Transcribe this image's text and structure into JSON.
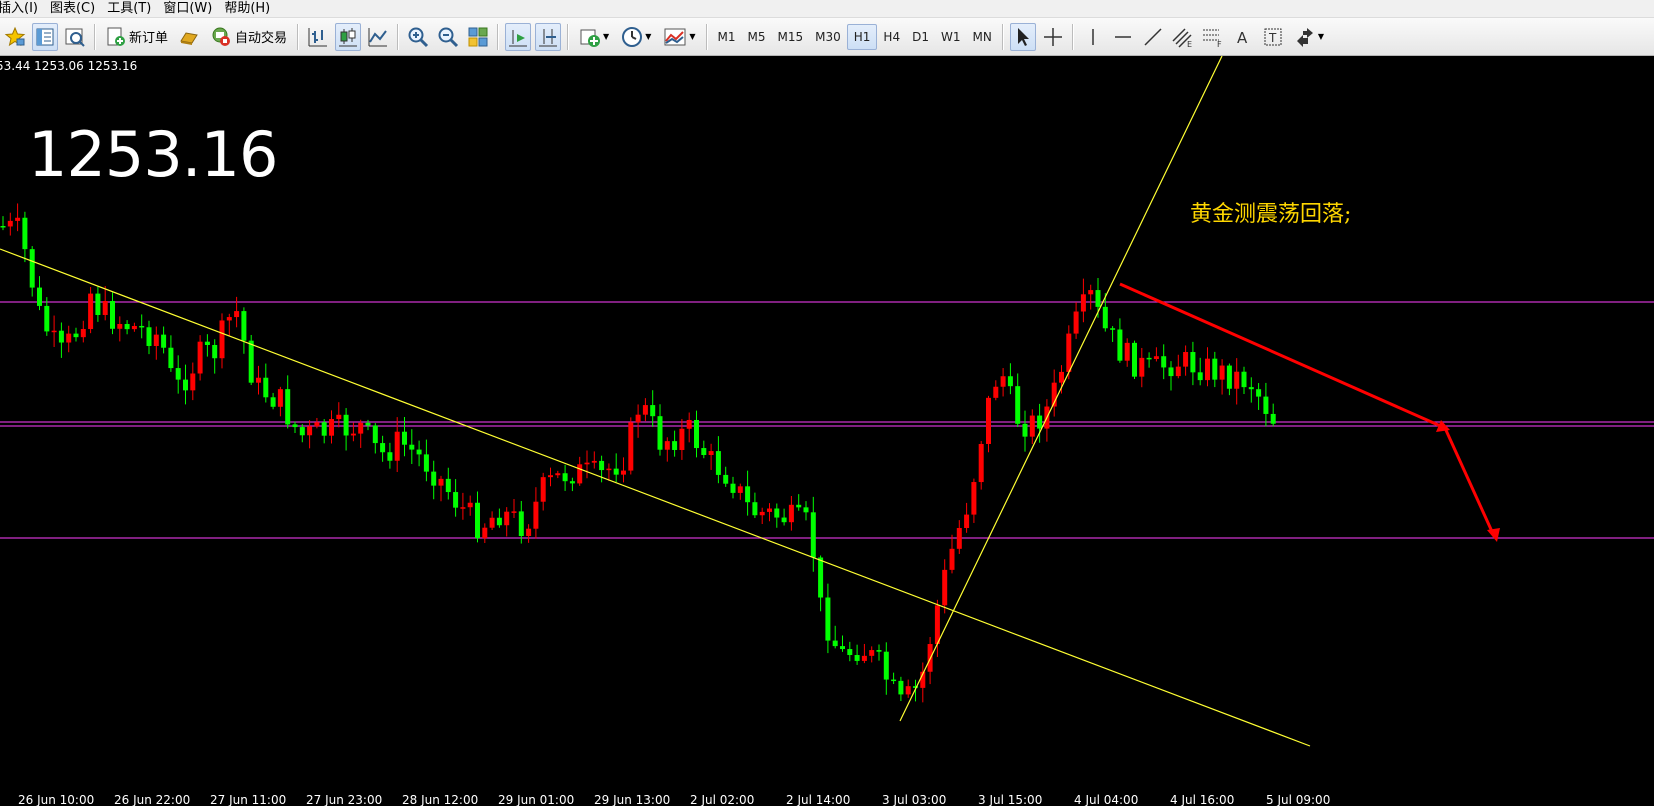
{
  "menu": {
    "items": [
      "插入(I)",
      "图表(C)",
      "工具(T)",
      "窗口(W)",
      "帮助(H)"
    ]
  },
  "toolbar": {
    "new_order_label": "新订单",
    "auto_trade_label": "自动交易",
    "timeframes": [
      "M1",
      "M5",
      "M15",
      "M30",
      "H1",
      "H4",
      "D1",
      "W1",
      "MN"
    ],
    "active_timeframe": "H1",
    "icons": [
      "profiles-icon",
      "market-watch-icon",
      "navigator-icon",
      "new-order-icon",
      "gold-icon",
      "auto-trading-icon",
      "bar-chart-icon",
      "candlestick-icon",
      "line-chart-icon",
      "zoom-in-icon",
      "zoom-out-icon",
      "tile-windows-icon",
      "auto-scroll-icon",
      "chart-shift-icon",
      "indicators-icon",
      "periods-icon",
      "templates-icon",
      "cursor-icon",
      "crosshair-icon",
      "vertical-line-icon",
      "horizontal-line-icon",
      "trend-line-icon",
      "equidistant-channel-icon",
      "fibonacci-icon",
      "text-icon",
      "text-label-icon",
      "arrows-icon"
    ]
  },
  "chart": {
    "ohlc_readout": "53.44 1253.06 1253.16",
    "big_price": "1253.16",
    "annotation": "黄金测震荡回落;",
    "time_labels": [
      "26 Jun 10:00",
      "26 Jun 22:00",
      "27 Jun 11:00",
      "27 Jun 23:00",
      "28 Jun 12:00",
      "29 Jun 01:00",
      "29 Jun 13:00",
      "2 Jul 02:00",
      "2 Jul 14:00",
      "3 Jul 03:00",
      "3 Jul 15:00",
      "4 Jul 04:00",
      "4 Jul 16:00",
      "5 Jul 09:00"
    ],
    "colors": {
      "background": "#000000",
      "bull_candle": "#ff0000",
      "bear_candle": "#00ff00",
      "horizontal_line": "#cc33cc",
      "trend_line": "#ffff33",
      "arrow": "#ff0000",
      "text": "#ffffff",
      "annotation": "#ffd700"
    }
  }
}
